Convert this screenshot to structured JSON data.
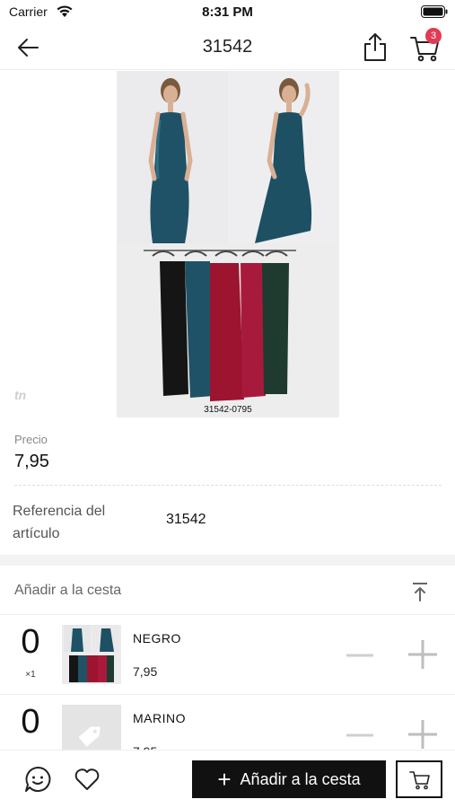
{
  "status": {
    "carrier": "Carrier",
    "time": "8:31 PM"
  },
  "nav": {
    "title": "31542",
    "cart_count": "3"
  },
  "gallery": {
    "caption": "31542-0795",
    "logo": "tn"
  },
  "product": {
    "price_label": "Precio",
    "price_value": "7,95",
    "ref_label": "Referencia del artículo",
    "ref_value": "31542"
  },
  "cart_section": {
    "title": "Añadir a la cesta",
    "variants": [
      {
        "qty": "0",
        "multiplier": "×1",
        "name": "NEGRO",
        "price": "7,95"
      },
      {
        "qty": "0",
        "multiplier": "",
        "name": "MARINO",
        "price": "7,95"
      }
    ]
  },
  "bottom": {
    "add_label": "Añadir a la cesta"
  },
  "colors": {
    "badge": "#e23a55",
    "primary_button": "#111111",
    "dress_teal": "#1f5266",
    "dress_red": "#9c1430",
    "dress_green": "#1f3a2e"
  }
}
